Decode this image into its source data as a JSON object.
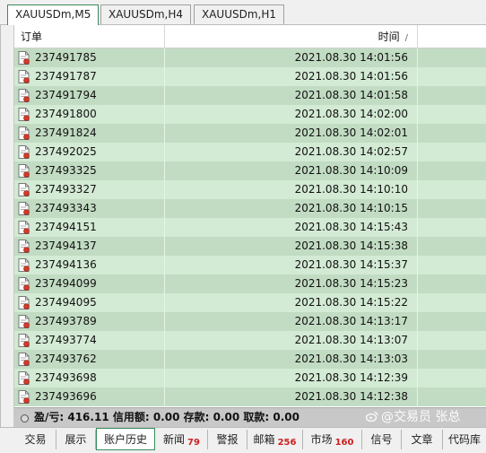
{
  "chart_tabs": [
    {
      "label": "XAUUSDm,M5",
      "active": true
    },
    {
      "label": "XAUUSDm,H4",
      "active": false
    },
    {
      "label": "XAUUSDm,H1",
      "active": false
    }
  ],
  "table": {
    "columns": {
      "order": "订单",
      "time": "时间",
      "sort_indicator": "/"
    },
    "rows": [
      {
        "order": "237491785",
        "time": "2021.08.30 14:01:56"
      },
      {
        "order": "237491787",
        "time": "2021.08.30 14:01:56"
      },
      {
        "order": "237491794",
        "time": "2021.08.30 14:01:58"
      },
      {
        "order": "237491800",
        "time": "2021.08.30 14:02:00"
      },
      {
        "order": "237491824",
        "time": "2021.08.30 14:02:01"
      },
      {
        "order": "237492025",
        "time": "2021.08.30 14:02:57"
      },
      {
        "order": "237493325",
        "time": "2021.08.30 14:10:09"
      },
      {
        "order": "237493327",
        "time": "2021.08.30 14:10:10"
      },
      {
        "order": "237493343",
        "time": "2021.08.30 14:10:15"
      },
      {
        "order": "237494151",
        "time": "2021.08.30 14:15:43"
      },
      {
        "order": "237494137",
        "time": "2021.08.30 14:15:38"
      },
      {
        "order": "237494136",
        "time": "2021.08.30 14:15:37"
      },
      {
        "order": "237494099",
        "time": "2021.08.30 14:15:23"
      },
      {
        "order": "237494095",
        "time": "2021.08.30 14:15:22"
      },
      {
        "order": "237493789",
        "time": "2021.08.30 14:13:17"
      },
      {
        "order": "237493774",
        "time": "2021.08.30 14:13:07"
      },
      {
        "order": "237493762",
        "time": "2021.08.30 14:13:03"
      },
      {
        "order": "237493698",
        "time": "2021.08.30 14:12:39"
      },
      {
        "order": "237493696",
        "time": "2021.08.30 14:12:38"
      }
    ]
  },
  "status": {
    "text": "盈/亏: 416.11  信用额: 0.00  存款: 0.00  取款: 0.00"
  },
  "watermark": {
    "text": "@交易员 张总"
  },
  "bottom_tabs": [
    {
      "label": "交易",
      "count": "",
      "active": false
    },
    {
      "label": "展示",
      "count": "",
      "active": false
    },
    {
      "label": "账户历史",
      "count": "",
      "active": true
    },
    {
      "label": "新闻",
      "count": "79",
      "active": false
    },
    {
      "label": "警报",
      "count": "",
      "active": false
    },
    {
      "label": "邮箱",
      "count": "256",
      "active": false
    },
    {
      "label": "市场",
      "count": "160",
      "active": false
    },
    {
      "label": "信号",
      "count": "",
      "active": false
    },
    {
      "label": "文章",
      "count": "",
      "active": false
    },
    {
      "label": "代码库",
      "count": "",
      "active": false
    }
  ],
  "colors": {
    "row_odd": "#c2dcc3",
    "row_even": "#d3ead4",
    "status_bar": "#c8c8c8",
    "count_red": "#cc2020"
  },
  "icons": {
    "order_row": "order-document-icon",
    "status": "status-bullet-icon",
    "watermark": "weibo-logo-icon"
  }
}
